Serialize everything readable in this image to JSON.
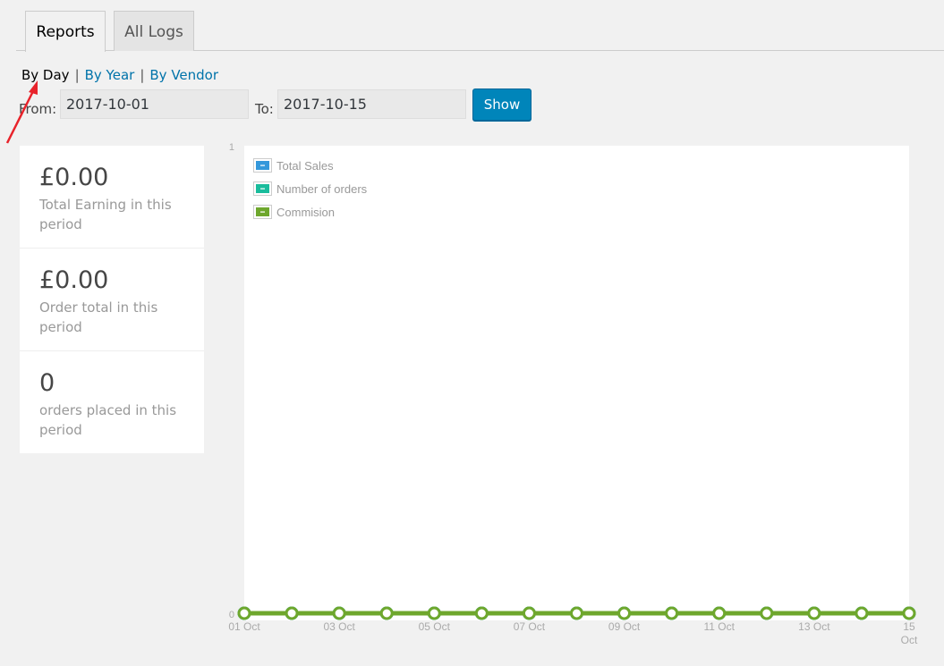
{
  "tabs": [
    {
      "label": "Reports",
      "active": true
    },
    {
      "label": "All Logs",
      "active": false
    }
  ],
  "subnav": {
    "current": "By Day",
    "links": [
      "By Year",
      "By Vendor"
    ],
    "separator": "|"
  },
  "filter": {
    "from_label": "From:",
    "from_value": "2017-10-01",
    "to_label": "To:",
    "to_value": "2017-10-15",
    "show_label": "Show"
  },
  "stats": [
    {
      "value": "£0.00",
      "label": "Total Earning in this period"
    },
    {
      "value": "£0.00",
      "label": "Order total in this period"
    },
    {
      "value": "0",
      "label": "orders placed in this period"
    }
  ],
  "colors": {
    "accent": "#0085ba",
    "link": "#0073aa",
    "total_sales": "#3498db",
    "orders": "#1abc9c",
    "commission": "#6ea72d",
    "annotation_arrow": "#e8232b"
  },
  "chart_data": {
    "type": "line",
    "ylim": [
      0,
      1
    ],
    "yticks": [
      "0",
      "1"
    ],
    "x": [
      "01 Oct",
      "02 Oct",
      "03 Oct",
      "04 Oct",
      "05 Oct",
      "06 Oct",
      "07 Oct",
      "08 Oct",
      "09 Oct",
      "10 Oct",
      "11 Oct",
      "12 Oct",
      "13 Oct",
      "14 Oct",
      "15 Oct"
    ],
    "xtick_labels": [
      "01 Oct",
      "03 Oct",
      "05 Oct",
      "07 Oct",
      "09 Oct",
      "11 Oct",
      "13 Oct",
      "15 Oct"
    ],
    "legend_position": "top-left",
    "series": [
      {
        "name": "Total Sales",
        "color": "#3498db",
        "values": [
          0,
          0,
          0,
          0,
          0,
          0,
          0,
          0,
          0,
          0,
          0,
          0,
          0,
          0,
          0
        ]
      },
      {
        "name": "Number of orders",
        "color": "#1abc9c",
        "values": [
          0,
          0,
          0,
          0,
          0,
          0,
          0,
          0,
          0,
          0,
          0,
          0,
          0,
          0,
          0
        ]
      },
      {
        "name": "Commision",
        "color": "#6ea72d",
        "values": [
          0,
          0,
          0,
          0,
          0,
          0,
          0,
          0,
          0,
          0,
          0,
          0,
          0,
          0,
          0
        ]
      }
    ]
  }
}
